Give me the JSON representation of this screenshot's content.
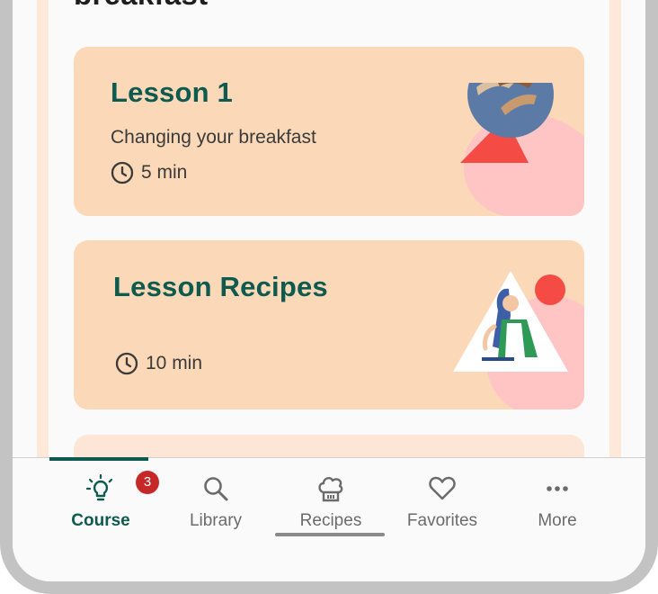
{
  "page": {
    "heading": "breakfast"
  },
  "cards": [
    {
      "title": "Lesson 1",
      "subtitle": "Changing your breakfast",
      "duration": "5 min"
    },
    {
      "title": "Lesson Recipes",
      "subtitle": "",
      "duration": "10 min"
    }
  ],
  "nav": {
    "tabs": [
      {
        "label": "Course",
        "icon": "lightbulb-icon",
        "active": true,
        "badge": "3"
      },
      {
        "label": "Library",
        "icon": "search-icon"
      },
      {
        "label": "Recipes",
        "icon": "chef-hat-icon"
      },
      {
        "label": "Favorites",
        "icon": "heart-icon"
      },
      {
        "label": "More",
        "icon": "more-dots-icon"
      }
    ]
  },
  "colors": {
    "accent": "#0e5a4e",
    "card": "#fbd9b8",
    "badge": "#c62828",
    "shape_red": "#f44b45",
    "shape_pink": "#ffc4c4"
  }
}
